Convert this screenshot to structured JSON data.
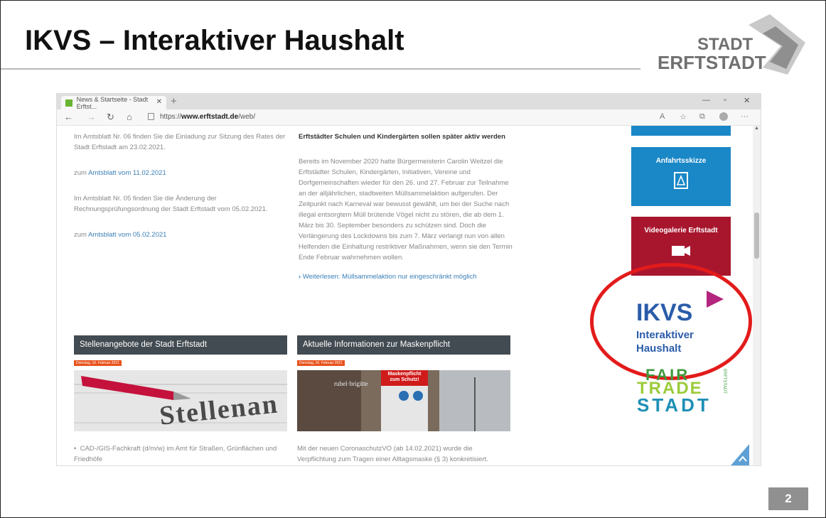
{
  "slide": {
    "title": "IKVS – Interaktiver Haushalt",
    "logo_line1": "STADT",
    "logo_line2": "ERFTSTADT",
    "page_number": "2"
  },
  "browser": {
    "tab_title": "News & Startseite - Stadt Erftst...",
    "url_prefix": "https://",
    "url_domain": "www.erftstadt.de",
    "url_path": "/web/",
    "icons": [
      "back-icon",
      "forward-icon",
      "refresh-icon",
      "home-icon",
      "lock-icon",
      "read-aloud-icon",
      "favorite-icon",
      "collections-icon",
      "profile-icon",
      "more-icon",
      "minimize-icon",
      "maximize-icon",
      "close-icon"
    ]
  },
  "left_column": {
    "para1": "Im Amtsblatt Nr. 06 finden Sie die Einladung zur Sitzung des Rates der Stadt Erftstadt am 23.02.2021.",
    "link1_prefix": "zum ",
    "link1_text": "Amtsblatt vom 11.02.2021",
    "para2": "Im Amtsblatt Nr. 05 finden Sie die Änderung der Rechnungsprüfungsordnung der Stadt Erftstadt vom 05.02.2021.",
    "link2_prefix": "zum ",
    "link2_text": "Amtsblatt vom 05.02.2021"
  },
  "mid_column": {
    "heading": "Erftstädter Schulen und Kindergärten sollen später aktiv werden",
    "body": "Bereits im November 2020 hatte Bürgermeisterin Carolin Weitzel die Erftstädter Schulen, Kindergärten, Initiativen, Vereine und Dorfgemeinschaften wieder für den 26. und 27. Februar zur Teilnahme an der alljährlichen, stadtweiten Müllsammelaktion aufgerufen. Der Zeitpunkt nach Karneval war bewusst gewählt, um bei der Suche nach illegal entsorgtem Müll brütende Vögel nicht zu stören, die ab dem 1. März bis 30. September besonders zu schützen sind. Doch die Verlängerung des Lockdowns bis zum 7. März verlangt nun von allen Helfenden die Einhaltung restriktiver Maßnahmen, wenn sie den Termin Ende Februar wahrnehmen wollen.",
    "more_link": "Weiterlesen: Müllsammelaktion nur eingeschränkt möglich"
  },
  "cards": [
    {
      "title": "Stellenangebote der Stadt Erftstadt",
      "date": "Dienstag, 16. Februar 2021",
      "image_text": "Stellenan",
      "bullet": "CAD-/GIS-Fachkraft (d/m/w) im Amt für Straßen, Grünflächen und Friedhöfe"
    },
    {
      "title": "Aktuelle Informationen zur Maskenpflicht",
      "date": "Dienstag, 16. Februar 2021",
      "image_text": "Maskenpflicht zum Schutz!",
      "sign_text": "rubel·brigitte",
      "text": "Mit der neuen CoronaschutzVO (ab 14.02.2021) wurde die Verpflichtung zum Tragen einer Alltagsmaske (§ 3) konkretisiert."
    }
  ],
  "sidebar": {
    "anfahrt": "Anfahrtsskizze",
    "video": "Videogalerie Erftstadt",
    "ikvs_big": "IKVS",
    "ikvs_line1": "Interaktiver",
    "ikvs_line2": "Haushalt",
    "fairtrade_lines": [
      "FAIR",
      "TRADE",
      "STADT"
    ],
    "fairtrade_small": "ERFTSTADT"
  },
  "colors": {
    "blue_tile": "#1a87c6",
    "red_tile": "#a8162e",
    "highlight_circle": "#e31b1b",
    "ikvs_blue": "#2a5caa",
    "ikvs_purple": "#b3257e",
    "card_header": "#424b52",
    "date_badge": "#e8521c"
  }
}
